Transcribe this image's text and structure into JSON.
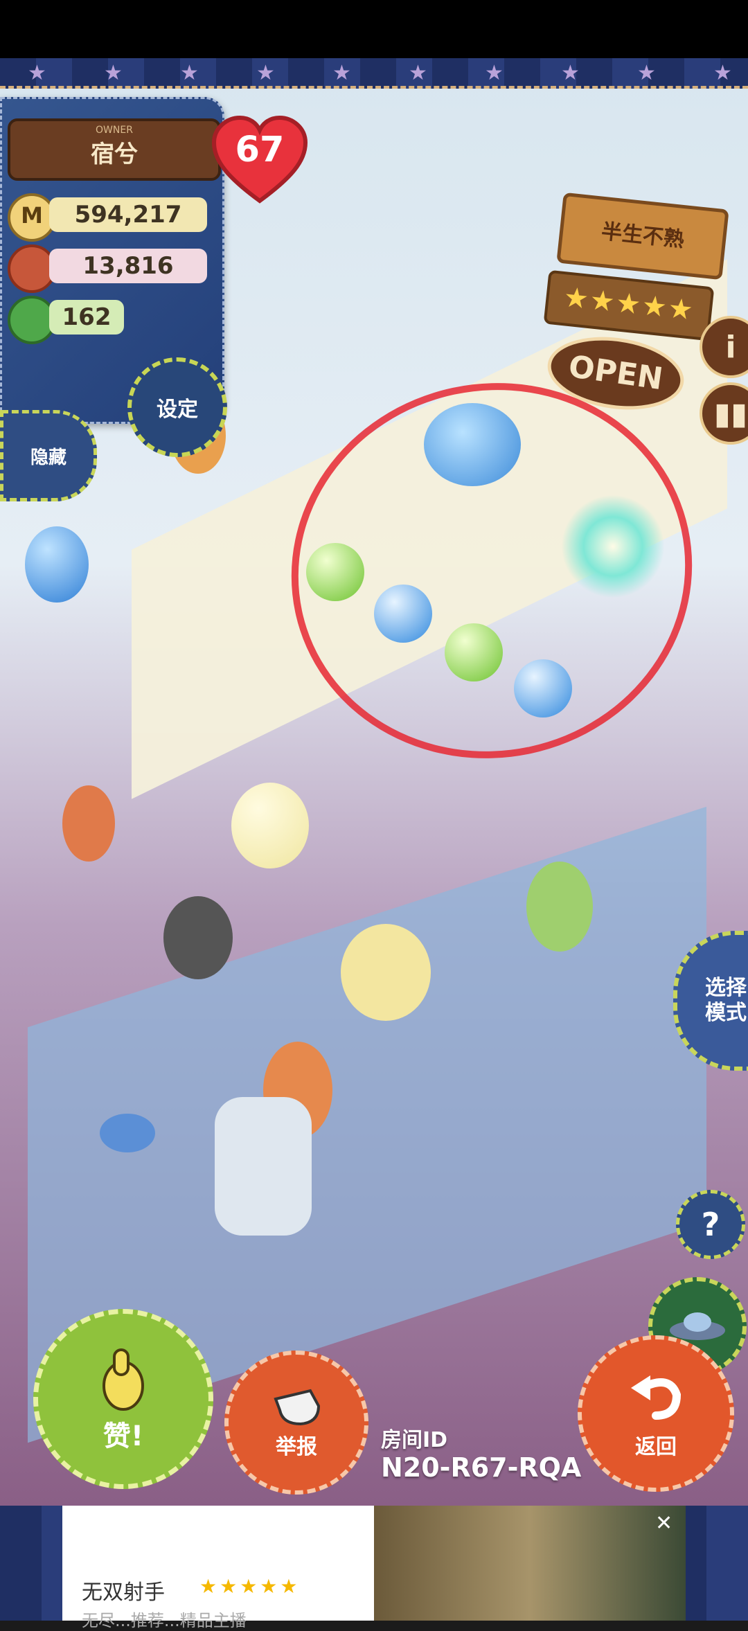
{
  "owner": {
    "label": "OWNER",
    "name": "宿兮",
    "level": "67"
  },
  "stats": {
    "coins": "594,217",
    "ingredients": "13,816",
    "clovers": "162"
  },
  "buttons": {
    "settings": "设定",
    "hide": "隐藏",
    "like": "赞!",
    "report": "举报",
    "back": "返回",
    "help": "?",
    "select_mode": "选择\n模式",
    "info": "i"
  },
  "shop": {
    "name": "半生不熟",
    "rating_stars": "★★★★★",
    "status": "OPEN"
  },
  "room": {
    "label": "房间ID",
    "id": "N20-R67-RQA"
  },
  "ad": {
    "title": "无双射手",
    "stars": "★★★★★",
    "subtitle": "无尽...推荐...精品主播",
    "close": "✕"
  },
  "colors": {
    "like_green": "#8fc23c",
    "report_red": "#e05a2e",
    "panel_blue": "#2f4d83",
    "mark_red": "#e6283a"
  }
}
